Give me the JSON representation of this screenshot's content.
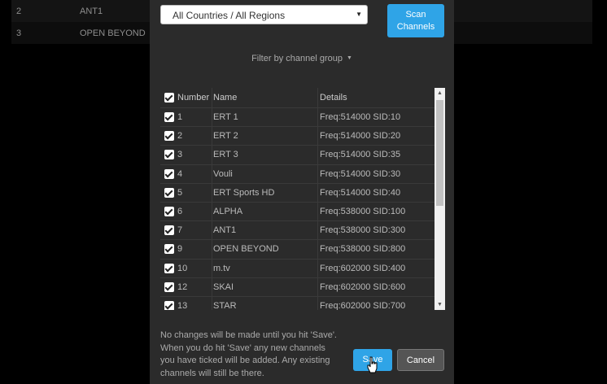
{
  "background_table": {
    "rows": [
      {
        "number": "2",
        "name": "ANT1"
      },
      {
        "number": "3",
        "name": "OPEN BEYOND"
      }
    ]
  },
  "modal": {
    "region_select": {
      "value": "All Countries / All Regions"
    },
    "scan_button": {
      "line1": "Scan",
      "line2": "Channels"
    },
    "filter_label": "Filter by channel group",
    "table": {
      "headers": {
        "number": "Number",
        "name": "Name",
        "details": "Details"
      },
      "rows": [
        {
          "number": "1",
          "name": "ERT 1",
          "details": "Freq:514000 SID:10"
        },
        {
          "number": "2",
          "name": "ERT 2",
          "details": "Freq:514000 SID:20"
        },
        {
          "number": "3",
          "name": "ERT 3",
          "details": "Freq:514000 SID:35"
        },
        {
          "number": "4",
          "name": "Vouli",
          "details": "Freq:514000 SID:30"
        },
        {
          "number": "5",
          "name": "ERT Sports HD",
          "details": "Freq:514000 SID:40"
        },
        {
          "number": "6",
          "name": "ALPHA",
          "details": "Freq:538000 SID:100"
        },
        {
          "number": "7",
          "name": "ANT1",
          "details": "Freq:538000 SID:300"
        },
        {
          "number": "9",
          "name": "OPEN BEYOND",
          "details": "Freq:538000 SID:800"
        },
        {
          "number": "10",
          "name": "m.tv",
          "details": "Freq:602000 SID:400"
        },
        {
          "number": "12",
          "name": "SKAI",
          "details": "Freq:602000 SID:600"
        },
        {
          "number": "13",
          "name": "STAR",
          "details": "Freq:602000 SID:700"
        }
      ]
    },
    "note": "No changes will be made until you hit 'Save'. When you do hit 'Save' any new channels you have ticked will be added. Any existing channels will still be there.",
    "save_label": "Save",
    "cancel_label": "Cancel"
  },
  "colors": {
    "primary": "#2fa4e7",
    "modal_bg": "#2b2b2b",
    "cancel": "#555555"
  }
}
